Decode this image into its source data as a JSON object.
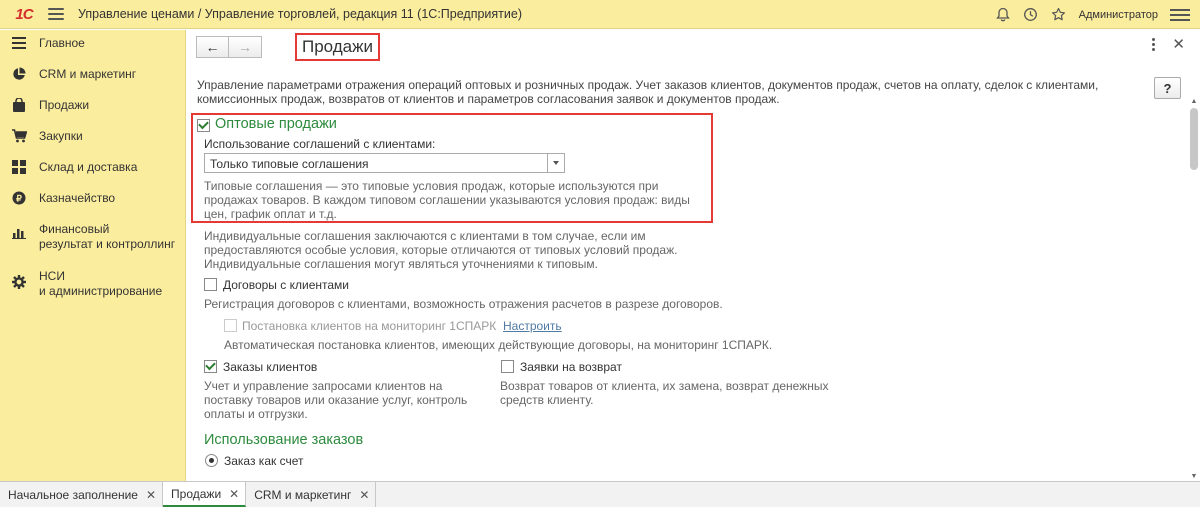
{
  "app": {
    "logo_text": "1С",
    "title": "Управление ценами / Управление торговлей, редакция 11   (1С:Предприятие)",
    "user": "Администратор"
  },
  "sidebar": {
    "items": [
      {
        "label": "Главное",
        "icon": "menu-lines-icon"
      },
      {
        "label": "CRM и маркетинг",
        "icon": "pie-chart-icon"
      },
      {
        "label": "Продажи",
        "icon": "shopping-bag-icon"
      },
      {
        "label": "Закупки",
        "icon": "cart-icon"
      },
      {
        "label": "Склад и доставка",
        "icon": "warehouse-grid-icon"
      },
      {
        "label": "Казначейство",
        "icon": "coin-icon"
      },
      {
        "label": "Финансовый\nрезультат и контроллинг",
        "icon": "bar-chart-icon"
      },
      {
        "label": "НСИ\nи администрирование",
        "icon": "gear-icon"
      }
    ]
  },
  "page": {
    "title": "Продажи",
    "help": "?",
    "description": "Управление параметрами отражения операций оптовых и розничных продаж. Учет заказов клиентов, документов продаж, счетов на оплату, сделок с клиентами, комиссионных продаж, возвратов от клиентов и параметров согласования заявок и документов продаж."
  },
  "wholesale": {
    "heading": "Оптовые продажи",
    "checked": true,
    "agreements_label": "Использование соглашений с клиентами:",
    "agreements_value": "Только типовые соглашения",
    "typical_note": "Типовые соглашения — это типовые условия продаж, которые используются при продажах товаров. В каждом типовом соглашении указываются условия продаж: виды цен, график оплат и т.д.",
    "individual_note": "Индивидуальные соглашения заключаются с клиентами в том случае, если им предоставляются особые условия, которые отличаются от типовых условий продаж. Индивидуальные соглашения могут являться уточнениями к типовым."
  },
  "contracts": {
    "label": "Договоры с клиентами",
    "checked": false,
    "note": "Регистрация договоров с клиентами, возможность отражения расчетов в разрезе договоров."
  },
  "monitoring": {
    "label": "Постановка клиентов на мониторинг 1СПАРК",
    "link": "Настроить",
    "note": "Автоматическая постановка клиентов, имеющих действующие договоры, на мониторинг 1СПАРК."
  },
  "orders": {
    "label": "Заказы клиентов",
    "checked": true,
    "note": "Учет и управление запросами клиентов на поставку товаров или оказание услуг, контроль оплаты и отгрузки."
  },
  "returns": {
    "label": "Заявки на возврат",
    "checked": false,
    "note": "Возврат товаров от клиента, их замена, возврат денежных средств клиенту."
  },
  "order_usage": {
    "heading": "Использование заказов",
    "option": "Заказ как счет"
  },
  "tabs": [
    {
      "label": "Начальное заполнение",
      "active": false
    },
    {
      "label": "Продажи",
      "active": true
    },
    {
      "label": "CRM и маркетинг",
      "active": false
    }
  ],
  "colors": {
    "panel": "#fbed9e",
    "accent_green": "#2e8b3e",
    "highlight_red": "#e53935"
  }
}
